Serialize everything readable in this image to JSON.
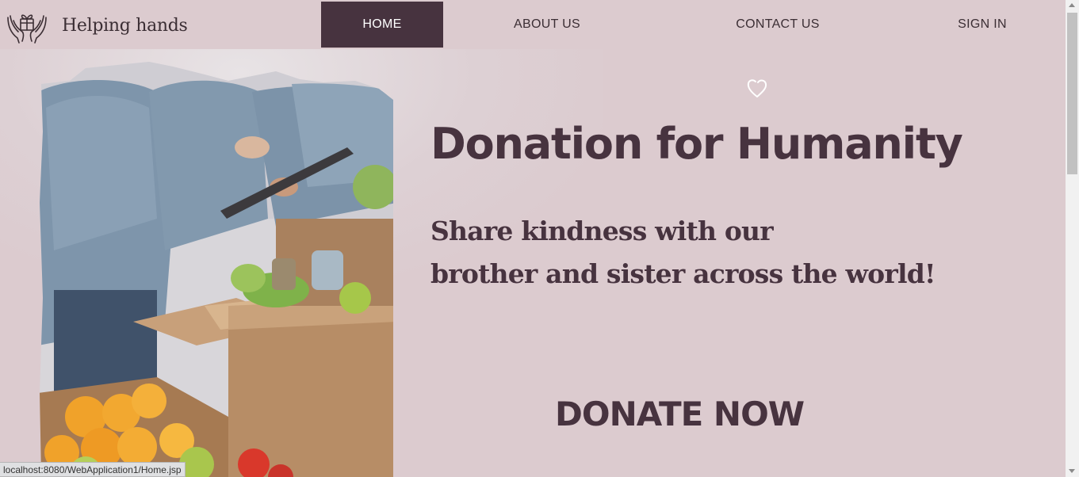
{
  "brand": {
    "name": "Helping hands",
    "icon": "hands-holding-gift-icon"
  },
  "nav": {
    "items": [
      {
        "label": "HOME",
        "active": true
      },
      {
        "label": "ABOUT US",
        "active": false
      },
      {
        "label": "CONTACT US",
        "active": false
      },
      {
        "label": "SIGN IN",
        "active": false
      }
    ]
  },
  "hero": {
    "decor_icon": "heart-icon",
    "title": "Donation for Humanity",
    "subtitle_line1": "Share kindness with our",
    "subtitle_line2": "brother and sister across the world!",
    "cta_label": "DONATE NOW",
    "image": "volunteers-packing-food-donation-boxes"
  },
  "status": {
    "url": "localhost:8080/WebApplication1/Home.jsp"
  },
  "colors": {
    "background": "#dccbcf",
    "primary": "#47333f",
    "active_nav_text": "#ffffff"
  }
}
